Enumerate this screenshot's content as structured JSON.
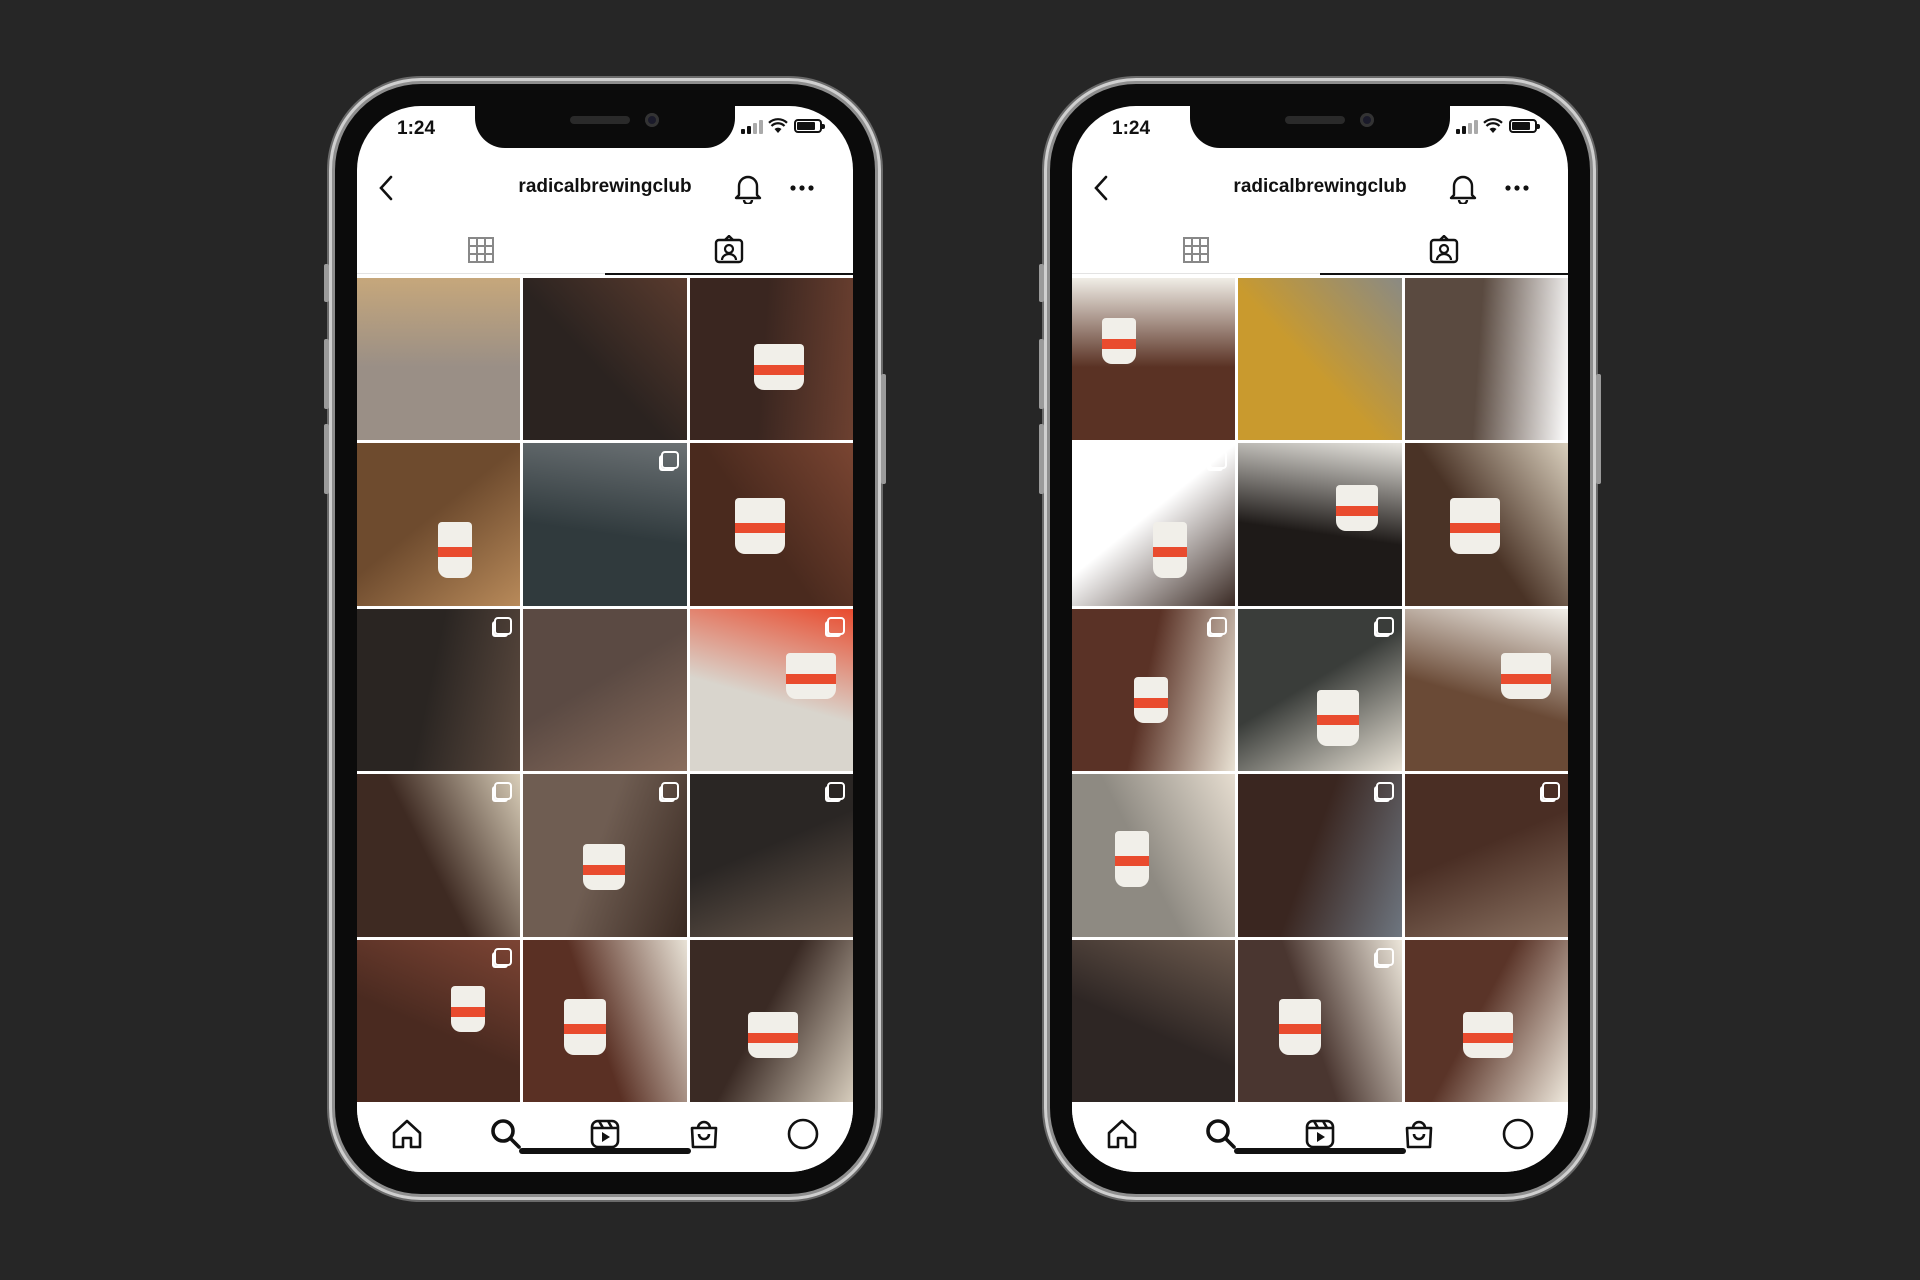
{
  "phones": [
    {
      "id": "left",
      "status_time": "1:24",
      "profile_handle": "radicalbrewingclub",
      "active_tab": "tagged",
      "icons": {
        "back": "chevron-left-icon",
        "notifications": "bell-icon",
        "more": "more-icon",
        "grid_tab": "grid-icon",
        "tagged_tab": "tagged-person-icon"
      },
      "photos": [
        {
          "bg": "#9a8f86",
          "accent": "#c6a77b",
          "multi": false,
          "cup": false
        },
        {
          "bg": "#2b2320",
          "accent": "#5a3b2e",
          "multi": false,
          "cup": false
        },
        {
          "bg": "#3a2620",
          "accent": "#6c4030",
          "multi": false,
          "cup": true
        },
        {
          "bg": "#6e4b2e",
          "accent": "#b88a5a",
          "multi": false,
          "cup": true
        },
        {
          "bg": "#303a3d",
          "accent": "#6b7174",
          "multi": true,
          "cup": false
        },
        {
          "bg": "#4a2a1e",
          "accent": "#7a4532",
          "multi": false,
          "cup": true
        },
        {
          "bg": "#2a2522",
          "accent": "#5c4a3f",
          "multi": true,
          "cup": false
        },
        {
          "bg": "#5b4a43",
          "accent": "#8a6e5e",
          "multi": false,
          "cup": false
        },
        {
          "bg": "#d9d5cd",
          "accent": "#e94b2e",
          "multi": true,
          "cup": true
        },
        {
          "bg": "#3e2a22",
          "accent": "#d8cdb8",
          "multi": true,
          "cup": false
        },
        {
          "bg": "#6f5d52",
          "accent": "#3a2a22",
          "multi": true,
          "cup": true
        },
        {
          "bg": "#2a2624",
          "accent": "#6a5a4e",
          "multi": true,
          "cup": false
        },
        {
          "bg": "#4a2a20",
          "accent": "#7c4434",
          "multi": true,
          "cup": true
        },
        {
          "bg": "#5a3024",
          "accent": "#e8e2d6",
          "multi": false,
          "cup": true
        },
        {
          "bg": "#3a2a24",
          "accent": "#d6ccbc",
          "multi": false,
          "cup": true
        }
      ],
      "nav": [
        "home-icon",
        "search-icon",
        "reels-icon",
        "shop-icon",
        "profile-icon"
      ],
      "active_nav": "search-icon"
    },
    {
      "id": "right",
      "status_time": "1:24",
      "profile_handle": "radicalbrewingclub",
      "active_tab": "grid",
      "icons": {
        "back": "chevron-left-icon",
        "notifications": "bell-icon",
        "more": "more-icon",
        "grid_tab": "grid-icon",
        "tagged_tab": "tagged-person-icon"
      },
      "photos": [
        {
          "bg": "#5a3224",
          "accent": "#f0ede6",
          "multi": false,
          "cup": true
        },
        {
          "bg": "#c99a2e",
          "accent": "#8a8a84",
          "multi": false,
          "cup": false
        },
        {
          "bg": "#5a4a40",
          "accent": "#ffffff",
          "multi": false,
          "cup": false
        },
        {
          "bg": "#ffffff",
          "accent": "#3a2a24",
          "multi": true,
          "cup": true
        },
        {
          "bg": "#1e1a18",
          "accent": "#e8e6e0",
          "multi": false,
          "cup": true
        },
        {
          "bg": "#4a3326",
          "accent": "#d9cfbd",
          "multi": false,
          "cup": true
        },
        {
          "bg": "#5a3226",
          "accent": "#e9e2d4",
          "multi": true,
          "cup": true
        },
        {
          "bg": "#3a3d3a",
          "accent": "#e8e2d6",
          "multi": true,
          "cup": true
        },
        {
          "bg": "#6a4a36",
          "accent": "#f2efe9",
          "multi": false,
          "cup": true
        },
        {
          "bg": "#8e8a82",
          "accent": "#e6ddd0",
          "multi": false,
          "cup": true
        },
        {
          "bg": "#3a2620",
          "accent": "#6e7680",
          "multi": true,
          "cup": false
        },
        {
          "bg": "#4a2e24",
          "accent": "#8a7262",
          "multi": true,
          "cup": false
        },
        {
          "bg": "#2e2624",
          "accent": "#6c5a4e",
          "multi": false,
          "cup": false
        },
        {
          "bg": "#4a3630",
          "accent": "#ece6da",
          "multi": true,
          "cup": true
        },
        {
          "bg": "#5a3428",
          "accent": "#efe9dd",
          "multi": false,
          "cup": true
        }
      ],
      "nav": [
        "home-icon",
        "search-icon",
        "reels-icon",
        "shop-icon",
        "profile-icon"
      ],
      "active_nav": "search-icon"
    }
  ]
}
